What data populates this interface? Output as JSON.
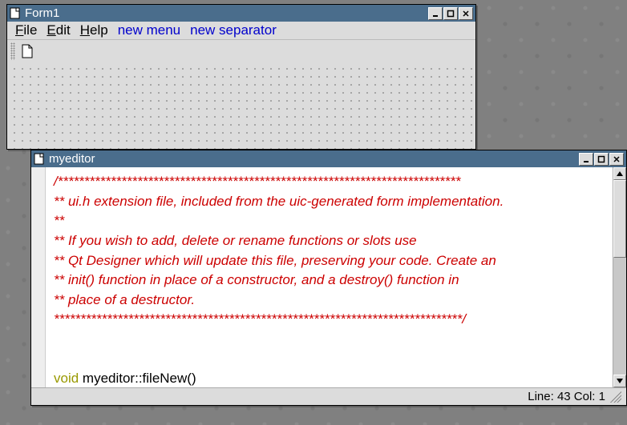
{
  "form1": {
    "title": "Form1",
    "menu": {
      "file": "File",
      "edit": "Edit",
      "help": "Help",
      "new_menu": "new menu",
      "new_separator": "new separator"
    },
    "toolbar": {
      "new_file_icon": "new-file-icon"
    }
  },
  "editor": {
    "title": "myeditor",
    "status": {
      "line_label": "Line:",
      "line": "43",
      "col_label": "Col:",
      "col": "1"
    },
    "code": {
      "l1": "/****************************************************************************",
      "l2": "** ui.h extension file, included from the uic-generated form implementation.",
      "l3": "**",
      "l4": "** If you wish to add, delete or rename functions or slots use",
      "l5": "** Qt Designer which will update this file, preserving your code. Create an",
      "l6": "** init() function in place of a constructor, and a destroy() function in",
      "l7": "** place of a destructor.",
      "l8": "*****************************************************************************/",
      "l9_kwd": "void",
      "l9_rest": " myeditor::fileNew()"
    }
  }
}
